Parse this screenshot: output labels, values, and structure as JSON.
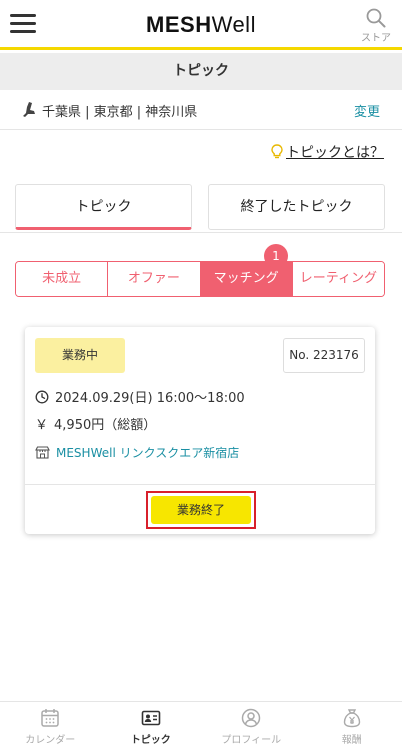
{
  "header": {
    "logo_bold": "MESH",
    "logo_regular": "Well",
    "store_label": "ストア",
    "accent": "#f5d800"
  },
  "page_title": "トピック",
  "location": {
    "areas": "千葉県 | 東京都 | 神奈川県",
    "change_label": "変更"
  },
  "what_is_topic": "トピックとは？",
  "tabs": [
    {
      "label": "トピック",
      "active": true
    },
    {
      "label": "終了したトピック",
      "active": false
    }
  ],
  "segments": [
    {
      "label": "未成立",
      "active": false
    },
    {
      "label": "オファー",
      "active": false
    },
    {
      "label": "マッチング",
      "active": true,
      "badge": "1"
    },
    {
      "label": "レーティング",
      "active": false
    }
  ],
  "card": {
    "status": "業務中",
    "number": "No. 223176",
    "datetime": "2024.09.29(日) 16:00〜18:00",
    "price_symbol": "￥",
    "price": "4,950円（総額）",
    "store": "MESHWell リンクスクエア新宿店",
    "finish_button": "業務終了"
  },
  "colors": {
    "brand_pink": "#f06070",
    "link_teal": "#1a8fa3",
    "button_yellow": "#f7e600",
    "highlight_red": "#d8202b"
  },
  "bottom_nav": [
    {
      "label": "カレンダー",
      "icon": "calendar-icon",
      "active": false
    },
    {
      "label": "トピック",
      "icon": "id-card-icon",
      "active": true
    },
    {
      "label": "プロフィール",
      "icon": "profile-icon",
      "active": false
    },
    {
      "label": "報酬",
      "icon": "money-bag-icon",
      "active": false
    }
  ]
}
